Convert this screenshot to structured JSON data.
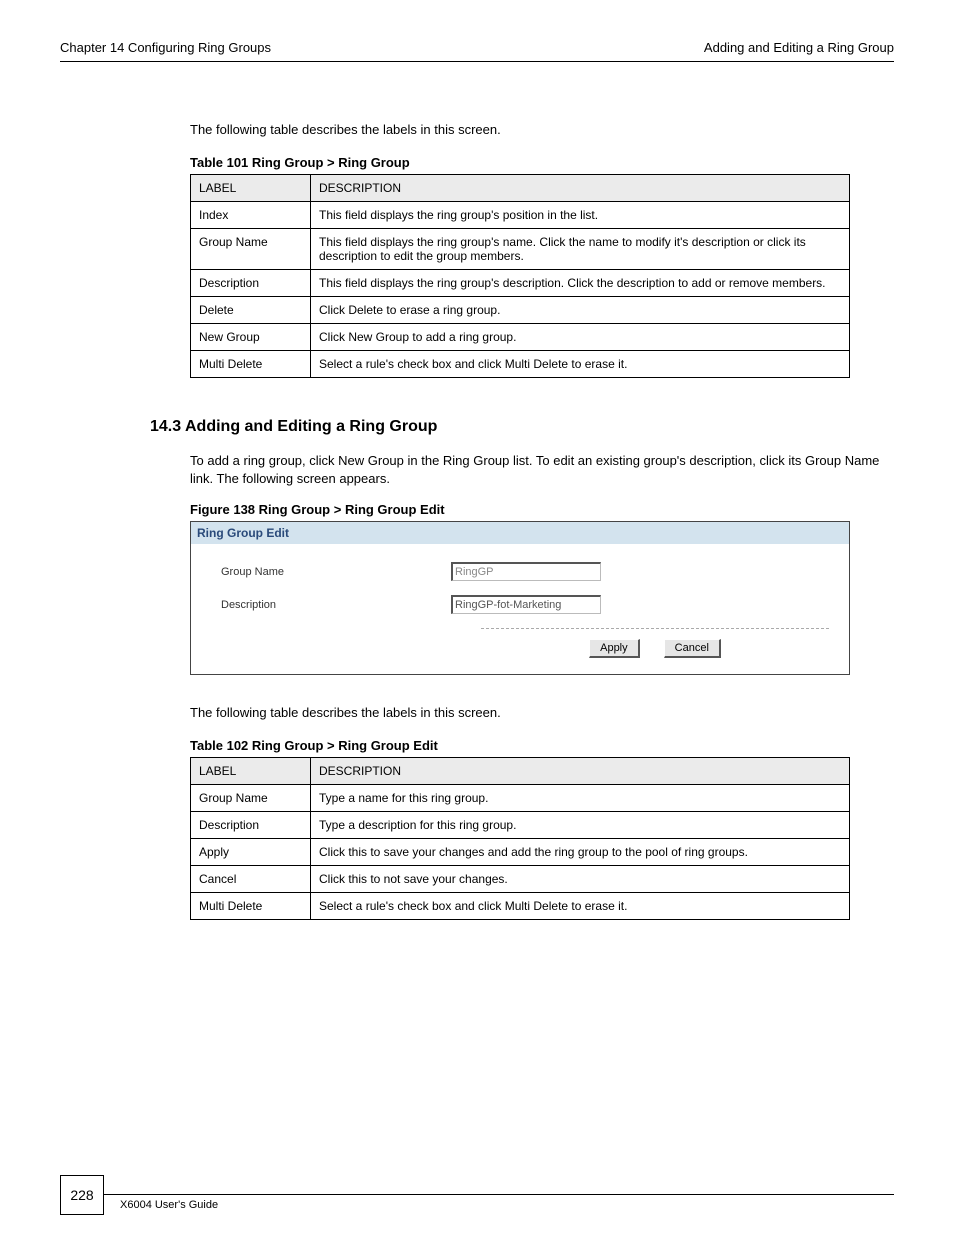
{
  "header": {
    "chapter_label": "Chapter 14 Configuring Ring Groups",
    "chapter_title": "Adding and Editing a Ring Group"
  },
  "table101": {
    "caption": "Table 101   Ring Group > Ring Group",
    "intro": "The following table describes the labels in this screen.",
    "headers": {
      "label": "LABEL",
      "desc": "DESCRIPTION"
    },
    "rows": [
      {
        "label": "Index",
        "desc": "This field displays the ring group's position in the list."
      },
      {
        "label": "Group Name",
        "desc": "This field displays the ring group's name. Click the name to modify it's description or click its description to edit the group members."
      },
      {
        "label": "Description",
        "desc": "This field displays the ring group's description. Click the description to add or remove members."
      },
      {
        "label": "Delete",
        "desc": "Click Delete to erase a ring group."
      },
      {
        "label": "New Group",
        "desc": "Click New Group to add a ring group."
      },
      {
        "label": "Multi Delete",
        "desc": "Select a rule's check box and click Multi Delete to erase it."
      }
    ]
  },
  "section": {
    "heading": "14.3  Adding and Editing a Ring Group",
    "para1": "To add a ring group, click New Group in the Ring Group list. To edit an existing group's description, click its Group Name link. The following screen appears.",
    "figure_caption": "Figure 138   Ring Group > Ring Group Edit"
  },
  "panel": {
    "title": "Ring Group Edit",
    "group_name_label": "Group Name",
    "group_name_value": "RingGP",
    "description_label": "Description",
    "description_value": "RingGP-fot-Marketing",
    "apply_label": "Apply",
    "cancel_label": "Cancel"
  },
  "table102": {
    "caption": "Table 102   Ring Group > Ring Group Edit",
    "intro": "The following table describes the labels in this screen.",
    "headers": {
      "label": "LABEL",
      "desc": "DESCRIPTION"
    },
    "rows": [
      {
        "label": "Group Name",
        "desc": "Type a name for this ring group."
      },
      {
        "label": "Description",
        "desc": "Type a description for this ring group."
      },
      {
        "label": "Apply",
        "desc": "Click this to save your changes and add the ring group to the pool of ring groups."
      },
      {
        "label": "Cancel",
        "desc": "Click this to not save your changes."
      },
      {
        "label": "Multi Delete",
        "desc": "Select a rule's check box and click Multi Delete to erase it."
      }
    ]
  },
  "footer": {
    "page_number": "228",
    "guide_title": "X6004 User's Guide"
  }
}
